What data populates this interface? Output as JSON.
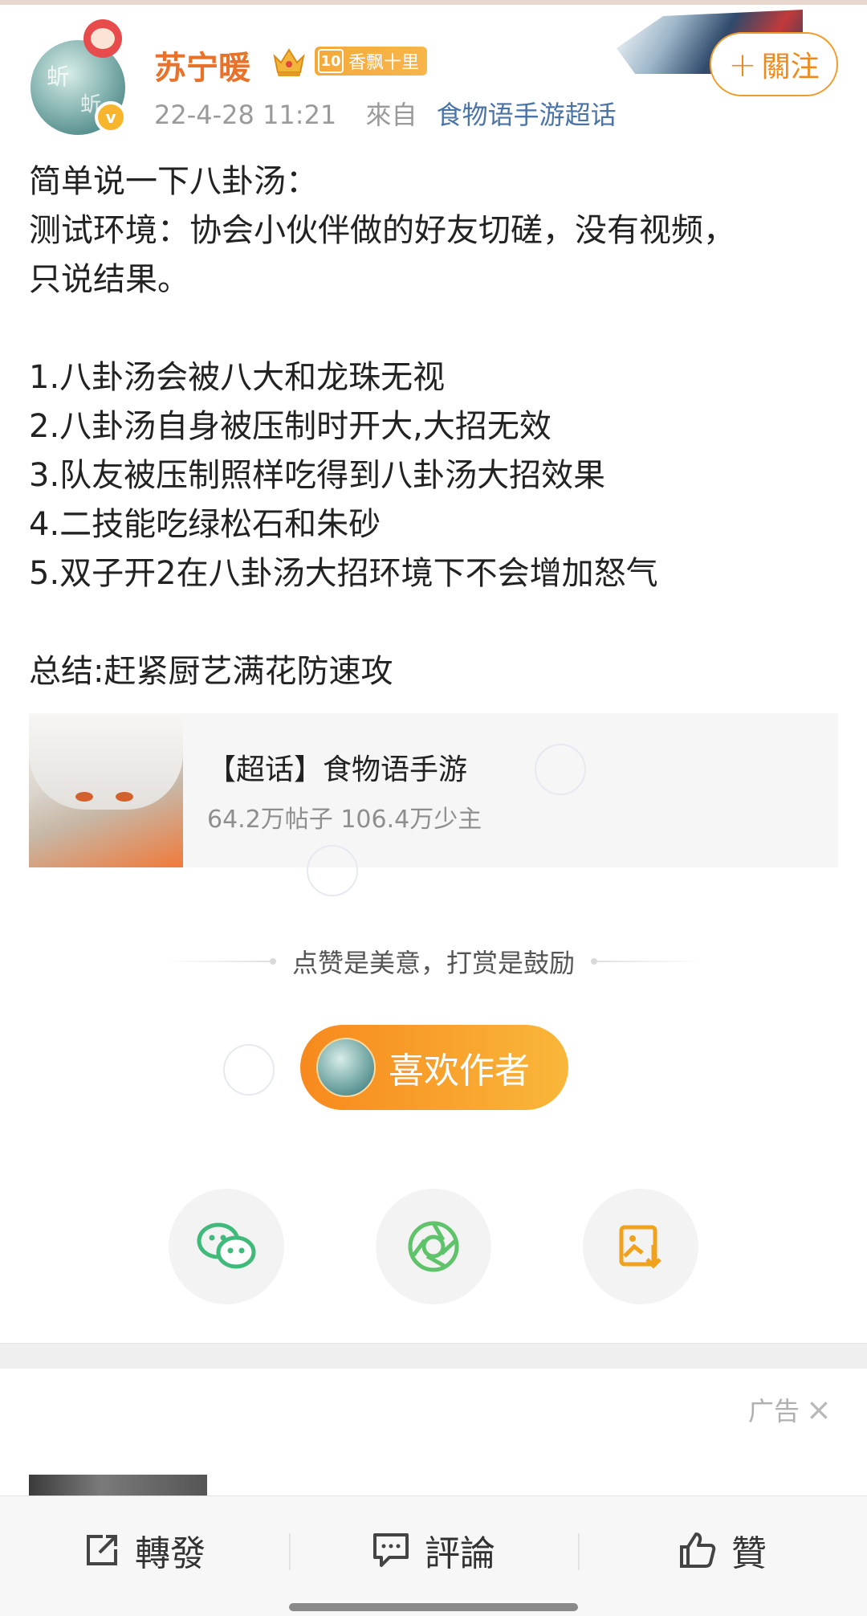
{
  "author": {
    "name": "苏宁暖",
    "level": "10",
    "level_text": "香飘十里",
    "avatar_ink_1": "蚚",
    "avatar_ink_2": "蚚",
    "verified_mark": "v"
  },
  "meta": {
    "time": "22-4-28 11:21",
    "from_label": "來自",
    "source": "食物语手游超话"
  },
  "follow": {
    "plus": "+",
    "label": "關注"
  },
  "post": {
    "lines": [
      "简单说一下八卦汤：",
      "测试环境：协会小伙伴做的好友切磋，没有视频，",
      "只说结果。",
      "",
      "1.八卦汤会被八大和龙珠无视",
      "2.八卦汤自身被压制时开大,大招无效",
      "3.队友被压制照样吃得到八卦汤大招效果",
      "4.二技能吃绿松石和朱砂",
      "5.双子开2在八卦汤大招环境下不会增加怒气",
      "",
      "总结:赶紧厨艺满花防速攻"
    ]
  },
  "topic_card": {
    "title": "【超话】食物语手游",
    "stats": "64.2万帖子 106.4万少主"
  },
  "tip": "点赞是美意，打赏是鼓励",
  "like_author": {
    "label": "喜欢作者"
  },
  "share": [
    {
      "icon": "wechat-icon",
      "color": "#3fba7a"
    },
    {
      "icon": "moments-icon",
      "color": "#5fc36a"
    },
    {
      "icon": "save-image-icon",
      "color": "#f0a21f"
    }
  ],
  "ad": {
    "label": "广告",
    "close": "×"
  },
  "bottom_bar": {
    "repost": "轉發",
    "comment": "評論",
    "like": "贊"
  }
}
